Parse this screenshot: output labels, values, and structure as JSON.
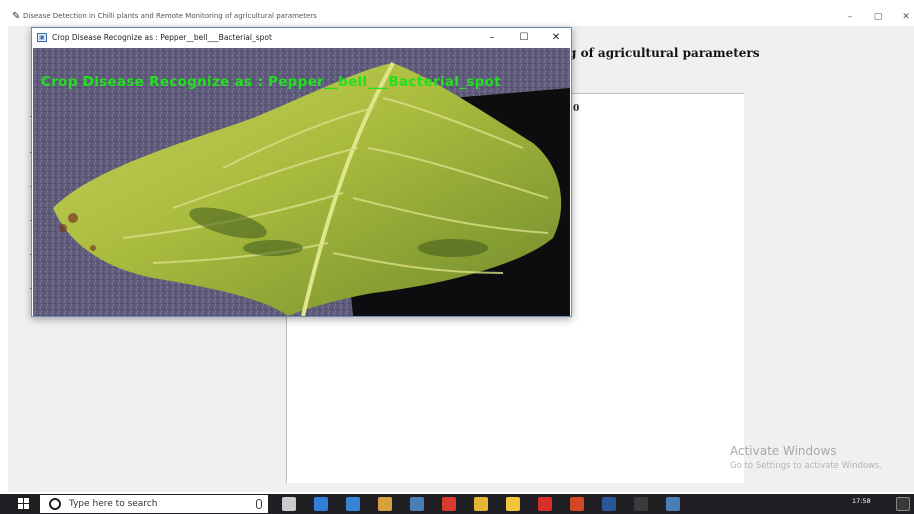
{
  "main_window": {
    "title": "Disease Detection in Chilli plants and Remote Monitoring of agricultural parameters",
    "heading_visible": "g of agricultural parameters",
    "canvas_corner_text": "0",
    "controls": {
      "minimize": "–",
      "maximize": "▢",
      "close": "✕"
    }
  },
  "popup": {
    "title": "Crop Disease Recognize as : Pepper__bell___Bacterial_spot",
    "overlay_text": "Crop Disease Recognize as : Pepper__bell___Bacterial_spot",
    "controls": {
      "minimize": "–",
      "maximize": "☐",
      "close": "✕"
    }
  },
  "watermark": {
    "line1": "Activate Windows",
    "line2": "Go to Settings to activate Windows."
  },
  "taskbar": {
    "search_placeholder": "Type here to search",
    "time": "17:58",
    "icons": [
      "start-icon",
      "task-view-icon",
      "edge-icon",
      "mail-icon",
      "store-icon",
      "python-icon",
      "red-app-icon",
      "chrome-icon",
      "file-explorer-icon",
      "acrobat-icon",
      "powerpoint-icon",
      "word-icon",
      "terminal-icon",
      "python-idle-icon"
    ],
    "icon_colors": [
      "#ffffff",
      "#cccccc",
      "#2f7ed8",
      "#3a84d6",
      "#d9a13b",
      "#4a7fb5",
      "#d83a2e",
      "#e4b632",
      "#f3c43c",
      "#d7302a",
      "#d24726",
      "#2b5797",
      "#3a3a3a",
      "#4a7fb5"
    ]
  },
  "colors": {
    "overlay_green": "#22e01e",
    "taskbar_bg": "#1f1f24",
    "window_bg": "#f0f0f0"
  }
}
